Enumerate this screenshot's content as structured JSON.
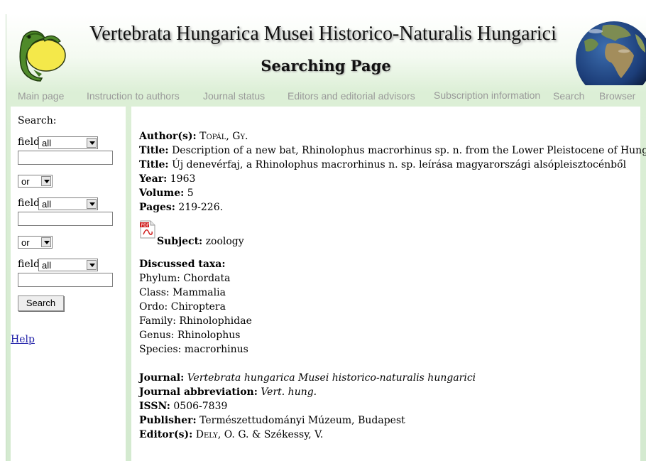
{
  "header": {
    "site_title": "Vertebrata Hungarica Musei Historico-Naturalis Hungarici",
    "page_title": "Searching Page"
  },
  "nav": [
    "Main page",
    "Instruction to authors",
    "Journal status",
    "Editors and editorial advisors",
    "Subscription information",
    "Search",
    "Browser"
  ],
  "sidebar": {
    "search_label": "Search:",
    "field_label": "field:",
    "field_values": [
      "all",
      "all",
      "all"
    ],
    "operator_values": [
      "or",
      "or"
    ],
    "search_button": "Search",
    "help_link": "Help"
  },
  "record": {
    "author_label": "Author(s):",
    "author_value": "Topál, Gy.",
    "title_label": "Title:",
    "title_value": "Description of a new bat, Rhinolophus macrorhinus sp. n. from the Lower Pleistocene of Hungary",
    "title2_label": "Title:",
    "title2_value": "Új denevérfaj, a Rhinolophus macrorhinus n. sp. leírása magyarországi alsópleisztocénből",
    "year_label": "Year:",
    "year_value": "1963",
    "volume_label": "Volume:",
    "volume_value": "5",
    "pages_label": "Pages:",
    "pages_value": "219-226.",
    "subject_label": "Subject:",
    "subject_value": "zoology",
    "taxa_label": "Discussed taxa:",
    "taxa": [
      "Phylum: Chordata",
      "Class: Mammalia",
      "Ordo: Chiroptera",
      "Family: Rhinolophidae",
      "Genus: Rhinolophus",
      "Species: macrorhinus"
    ],
    "journal_label": "Journal:",
    "journal_value": "Vertebrata hungarica Musei historico-naturalis hungarici",
    "abbrev_label": "Journal abbreviation:",
    "abbrev_value": "Vert. hung.",
    "issn_label": "ISSN:",
    "issn_value": "0506-7839",
    "publisher_label": "Publisher:",
    "publisher_value": "Természettudományi Múzeum, Budapest",
    "editor_label": "Editor(s):",
    "editor_value_sc": "Dely",
    "editor_value_rest": ", O. G. & Székessy, V."
  },
  "icons": {
    "pdf": "pdf-file-icon",
    "frog": "frog-logo",
    "globe": "globe-logo"
  },
  "colors": {
    "link": "#1a1aa6",
    "nav_text": "#9a9a9a",
    "frame_green": "#d4ead0"
  }
}
